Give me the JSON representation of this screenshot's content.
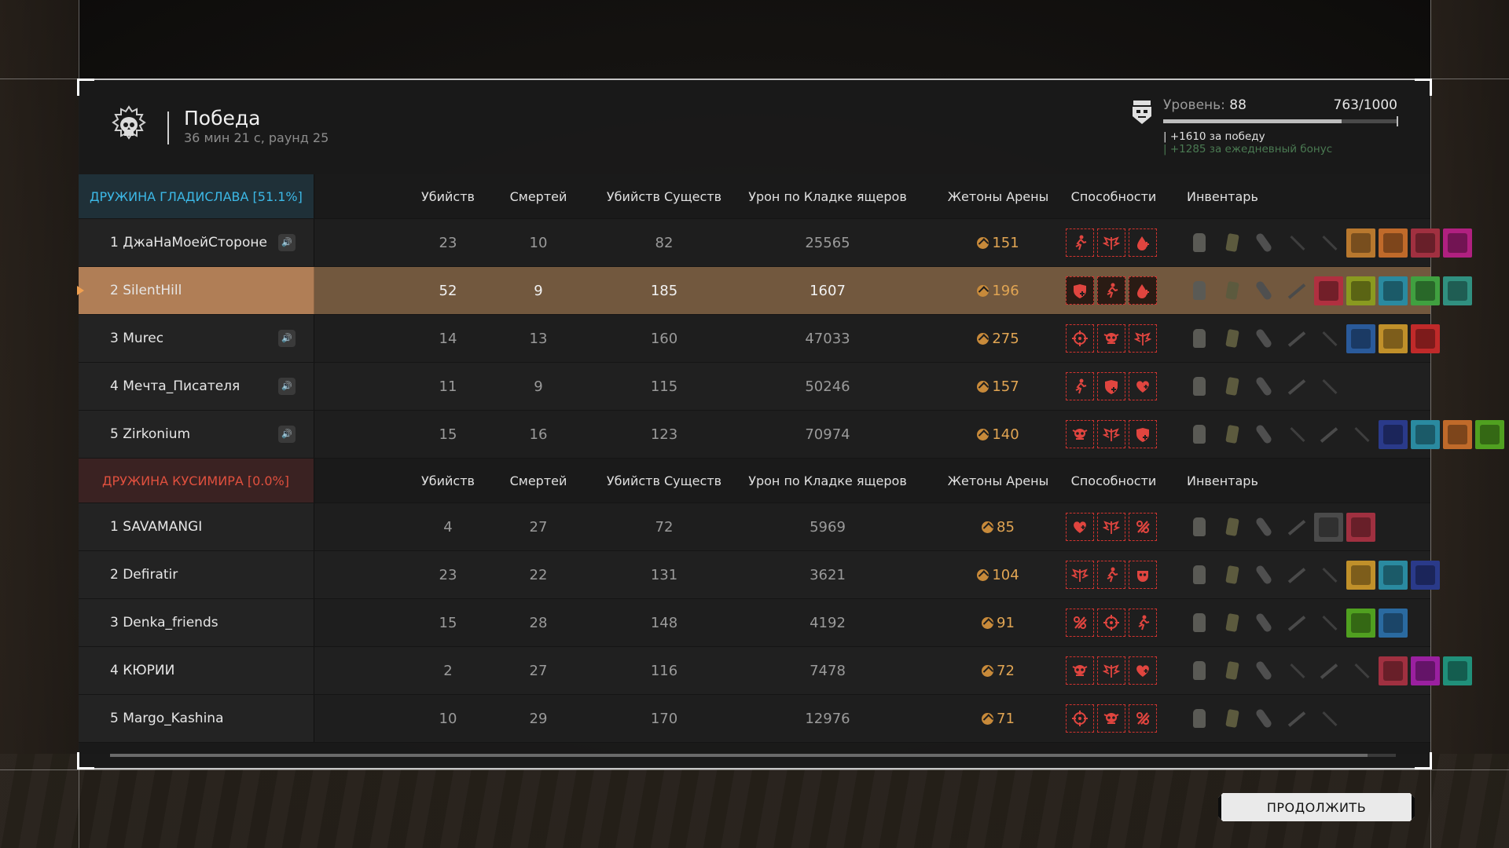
{
  "header": {
    "result": "Победа",
    "match_meta": "36 мин 21 с, раунд 25"
  },
  "level": {
    "label": "Уровень:",
    "value": "88",
    "xp_text": "763/1000",
    "xp_fraction": 0.763,
    "bonus_win": "| +1610 за победу",
    "bonus_daily": "| +1285 за ежедневный бонус"
  },
  "columns": [
    "Убийств",
    "Смертей",
    "Убийств Существ",
    "Урон по Кладке ящеров",
    "Жетоны Арены",
    "Способности",
    "Инвентарь"
  ],
  "teams": [
    {
      "name": "ДРУЖИНА ГЛАДИСЛАВА [51.1%]",
      "color": "#3cb8e6",
      "players": [
        {
          "name": "1 ДжаНаМоейСтороне",
          "kills": "23",
          "deaths": "10",
          "creatures": "82",
          "damage": "25565",
          "tokens": "151",
          "speaker": true,
          "me": false
        },
        {
          "name": "2 SilentHill",
          "kills": "52",
          "deaths": "9",
          "creatures": "185",
          "damage": "1607",
          "tokens": "196",
          "speaker": false,
          "me": true
        },
        {
          "name": "3 Murec",
          "kills": "14",
          "deaths": "13",
          "creatures": "160",
          "damage": "47033",
          "tokens": "275",
          "speaker": true,
          "me": false
        },
        {
          "name": "4 Мечта_Писателя",
          "kills": "11",
          "deaths": "9",
          "creatures": "115",
          "damage": "50246",
          "tokens": "157",
          "speaker": true,
          "me": false
        },
        {
          "name": "5 Zirkonium",
          "kills": "15",
          "deaths": "16",
          "creatures": "123",
          "damage": "70974",
          "tokens": "140",
          "speaker": true,
          "me": false
        }
      ]
    },
    {
      "name": "ДРУЖИНА КУСИМИРА [0.0%]",
      "color": "#e0503e",
      "players": [
        {
          "name": "1 SAVAMANGI",
          "kills": "4",
          "deaths": "27",
          "creatures": "72",
          "damage": "5969",
          "tokens": "85",
          "speaker": false,
          "me": false
        },
        {
          "name": "2 Defiratir",
          "kills": "23",
          "deaths": "22",
          "creatures": "131",
          "damage": "3621",
          "tokens": "104",
          "speaker": false,
          "me": false
        },
        {
          "name": "3 Denka_friends",
          "kills": "15",
          "deaths": "28",
          "creatures": "148",
          "damage": "4192",
          "tokens": "91",
          "speaker": false,
          "me": false
        },
        {
          "name": "4 КЮРИИ",
          "kills": "2",
          "deaths": "27",
          "creatures": "116",
          "damage": "7478",
          "tokens": "72",
          "speaker": false,
          "me": false
        },
        {
          "name": "5 Margo_Kashina",
          "kills": "10",
          "deaths": "29",
          "creatures": "170",
          "damage": "12976",
          "tokens": "71",
          "speaker": false,
          "me": false
        }
      ]
    }
  ],
  "icons": {
    "speaker": "🔊",
    "ability_color": "#d0332f",
    "token_color": "#e1a553"
  },
  "continue_label": "ПРОДОЛЖИТЬ"
}
